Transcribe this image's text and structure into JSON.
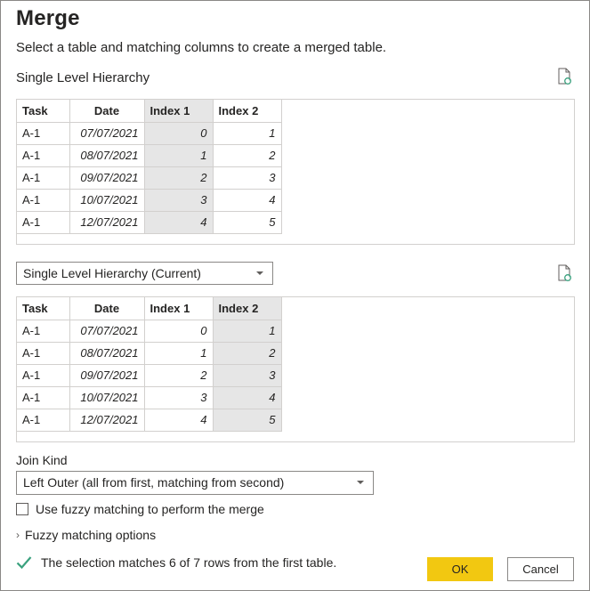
{
  "dialog": {
    "title": "Merge",
    "subtitle": "Select a table and matching columns to create a merged table."
  },
  "first_table": {
    "name": "Single Level Hierarchy",
    "columns": [
      "Task",
      "Date",
      "Index 1",
      "Index 2"
    ],
    "selected_column": "Index 1",
    "rows": [
      [
        "A-1",
        "07/07/2021",
        "0",
        "1"
      ],
      [
        "A-1",
        "08/07/2021",
        "1",
        "2"
      ],
      [
        "A-1",
        "09/07/2021",
        "2",
        "3"
      ],
      [
        "A-1",
        "10/07/2021",
        "3",
        "4"
      ],
      [
        "A-1",
        "12/07/2021",
        "4",
        "5"
      ]
    ]
  },
  "second_table": {
    "selector_value": "Single Level Hierarchy (Current)",
    "columns": [
      "Task",
      "Date",
      "Index 1",
      "Index 2"
    ],
    "selected_column": "Index 2",
    "rows": [
      [
        "A-1",
        "07/07/2021",
        "0",
        "1"
      ],
      [
        "A-1",
        "08/07/2021",
        "1",
        "2"
      ],
      [
        "A-1",
        "09/07/2021",
        "2",
        "3"
      ],
      [
        "A-1",
        "10/07/2021",
        "3",
        "4"
      ],
      [
        "A-1",
        "12/07/2021",
        "4",
        "5"
      ]
    ]
  },
  "join": {
    "label": "Join Kind",
    "value": "Left Outer (all from first, matching from second)"
  },
  "fuzzy": {
    "checkbox_label": "Use fuzzy matching to perform the merge",
    "checked": false,
    "options_label": "Fuzzy matching options"
  },
  "status": {
    "text": "The selection matches 6 of 7 rows from the first table."
  },
  "buttons": {
    "ok": "OK",
    "cancel": "Cancel"
  },
  "colors": {
    "accent": "#f2c811",
    "selected_column_bg": "#e6e6e6",
    "success_check": "#3aa17e"
  },
  "icons": {
    "refresh": "refresh-document-icon",
    "check": "checkmark-icon",
    "dropdown": "chevron-down-icon",
    "expand": "chevron-right-icon"
  }
}
